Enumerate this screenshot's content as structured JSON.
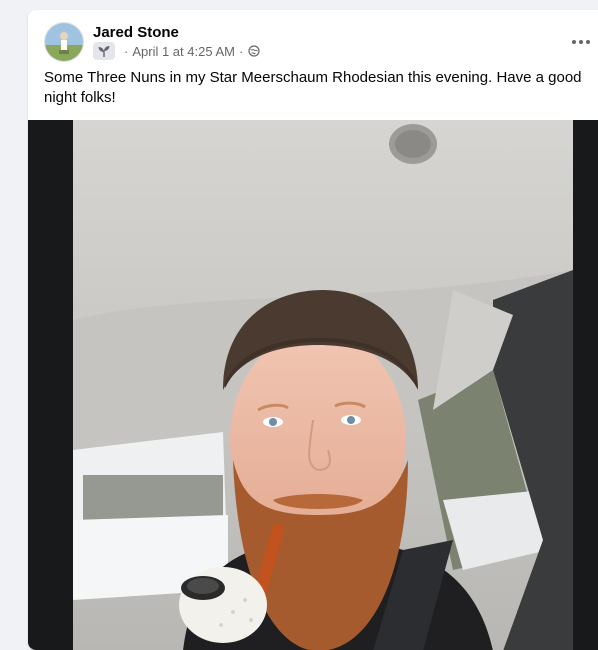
{
  "post": {
    "author_name": "Jared Stone",
    "badge_icon": "seedling-icon",
    "separator": "·",
    "timestamp": "April 1 at 4:25 AM",
    "audience_icon": "public-globe-icon",
    "more_icon": "more-horizontal-icon",
    "text": "Some Three Nuns in my Star Meerschaum Rhodesian this evening. Have a good night folks!",
    "photo_description": "man-with-beanie-beard-and-pipe-in-car"
  },
  "colors": {
    "page_background": "#f0f2f5",
    "card_background": "#ffffff",
    "primary_text": "#050505",
    "secondary_text": "#65676b",
    "media_background": "#18191a"
  }
}
